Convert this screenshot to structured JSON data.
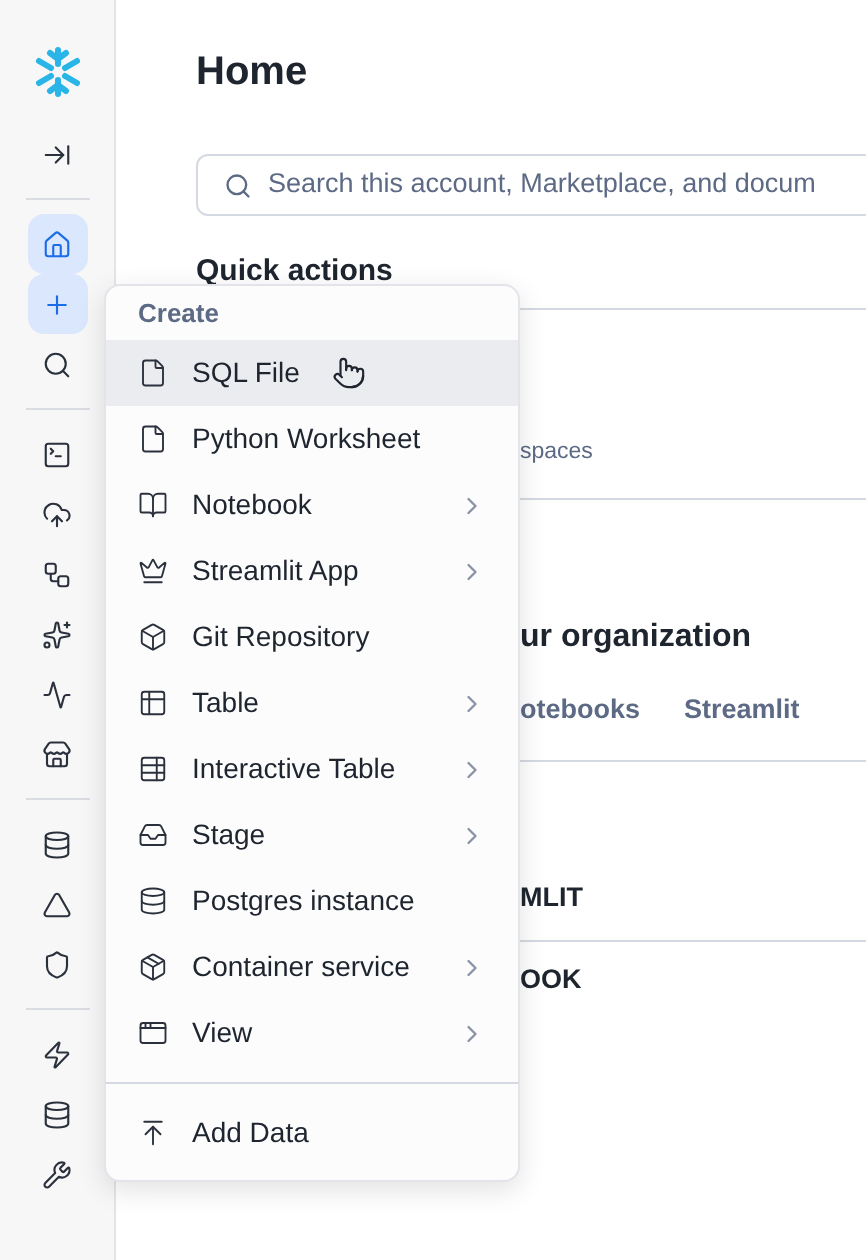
{
  "sidebar": {
    "groups": [
      {
        "items": [
          {
            "selected": false
          }
        ]
      },
      {
        "items": [
          {
            "selected": true
          },
          {
            "selected": true
          },
          {
            "selected": false
          }
        ]
      },
      {
        "items": [
          {
            "selected": false
          },
          {
            "selected": false
          },
          {
            "selected": false
          },
          {
            "selected": false
          },
          {
            "selected": false
          },
          {
            "selected": false
          }
        ]
      },
      {
        "items": [
          {
            "selected": false
          },
          {
            "selected": false
          },
          {
            "selected": false
          }
        ]
      },
      {
        "items": [
          {
            "selected": false
          },
          {
            "selected": false
          },
          {
            "selected": false
          }
        ]
      }
    ]
  },
  "page": {
    "title": "Home",
    "search": {
      "placeholder": "Search this account, Marketplace, and docum"
    },
    "quick_actions": {
      "heading": "Quick actions",
      "visible_text": "spaces"
    },
    "organization": {
      "heading": "ur organization",
      "tabs": [
        {
          "label": "otebooks",
          "selected": false
        },
        {
          "label": "Streamlit",
          "selected": false
        }
      ],
      "rows": [
        "MLIT",
        "OOK"
      ]
    }
  },
  "create_menu": {
    "heading": "Create",
    "sections": [
      {
        "items": [
          {
            "label": "SQL File",
            "submenu": false,
            "selected": true
          },
          {
            "label": "Python Worksheet",
            "submenu": false,
            "selected": false
          },
          {
            "label": "Notebook",
            "submenu": true,
            "selected": false
          },
          {
            "label": "Streamlit App",
            "submenu": true,
            "selected": false
          },
          {
            "label": "Git Repository",
            "submenu": false,
            "selected": false
          },
          {
            "label": "Table",
            "submenu": true,
            "selected": false
          },
          {
            "label": "Interactive Table",
            "submenu": true,
            "selected": false
          },
          {
            "label": "Stage",
            "submenu": true,
            "selected": false
          },
          {
            "label": "Postgres instance",
            "submenu": false,
            "selected": false
          },
          {
            "label": "Container service",
            "submenu": true,
            "selected": false
          },
          {
            "label": "View",
            "submenu": true,
            "selected": false
          }
        ]
      },
      {
        "items": [
          {
            "label": "Add Data",
            "submenu": false,
            "selected": false
          }
        ]
      }
    ]
  }
}
